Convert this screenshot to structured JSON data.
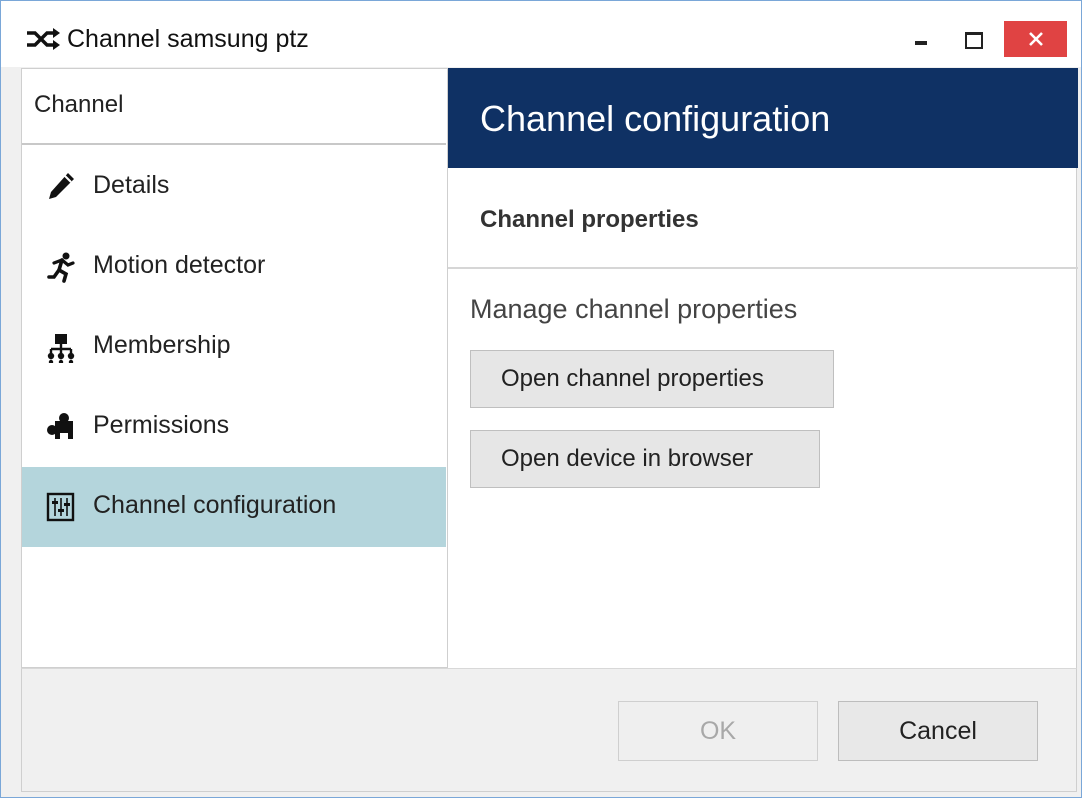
{
  "window": {
    "title": "Channel samsung ptz",
    "title_icon": "shuffle-icon",
    "controls": [
      "minimize-icon",
      "maximize-icon",
      "close-icon"
    ],
    "close_color": "#e04343"
  },
  "sidebar": {
    "header": "Channel",
    "items": [
      {
        "label": "Details",
        "icon": "pencil-icon",
        "active": false
      },
      {
        "label": "Motion detector",
        "icon": "running-person-icon",
        "active": false
      },
      {
        "label": "Membership",
        "icon": "hierarchy-icon",
        "active": false
      },
      {
        "label": "Permissions",
        "icon": "puzzle-icon",
        "active": false
      },
      {
        "label": "Channel configuration",
        "icon": "sliders-icon",
        "active": true
      }
    ],
    "active_color": "#b4d5dc"
  },
  "main": {
    "header": "Channel configuration",
    "header_color": "#0f3164",
    "section_title": "Channel properties",
    "section_description": "Manage channel properties",
    "actions": [
      {
        "label": "Open channel properties"
      },
      {
        "label": "Open device in browser"
      }
    ]
  },
  "footer": {
    "ok_label": "OK",
    "ok_enabled": false,
    "cancel_label": "Cancel"
  }
}
